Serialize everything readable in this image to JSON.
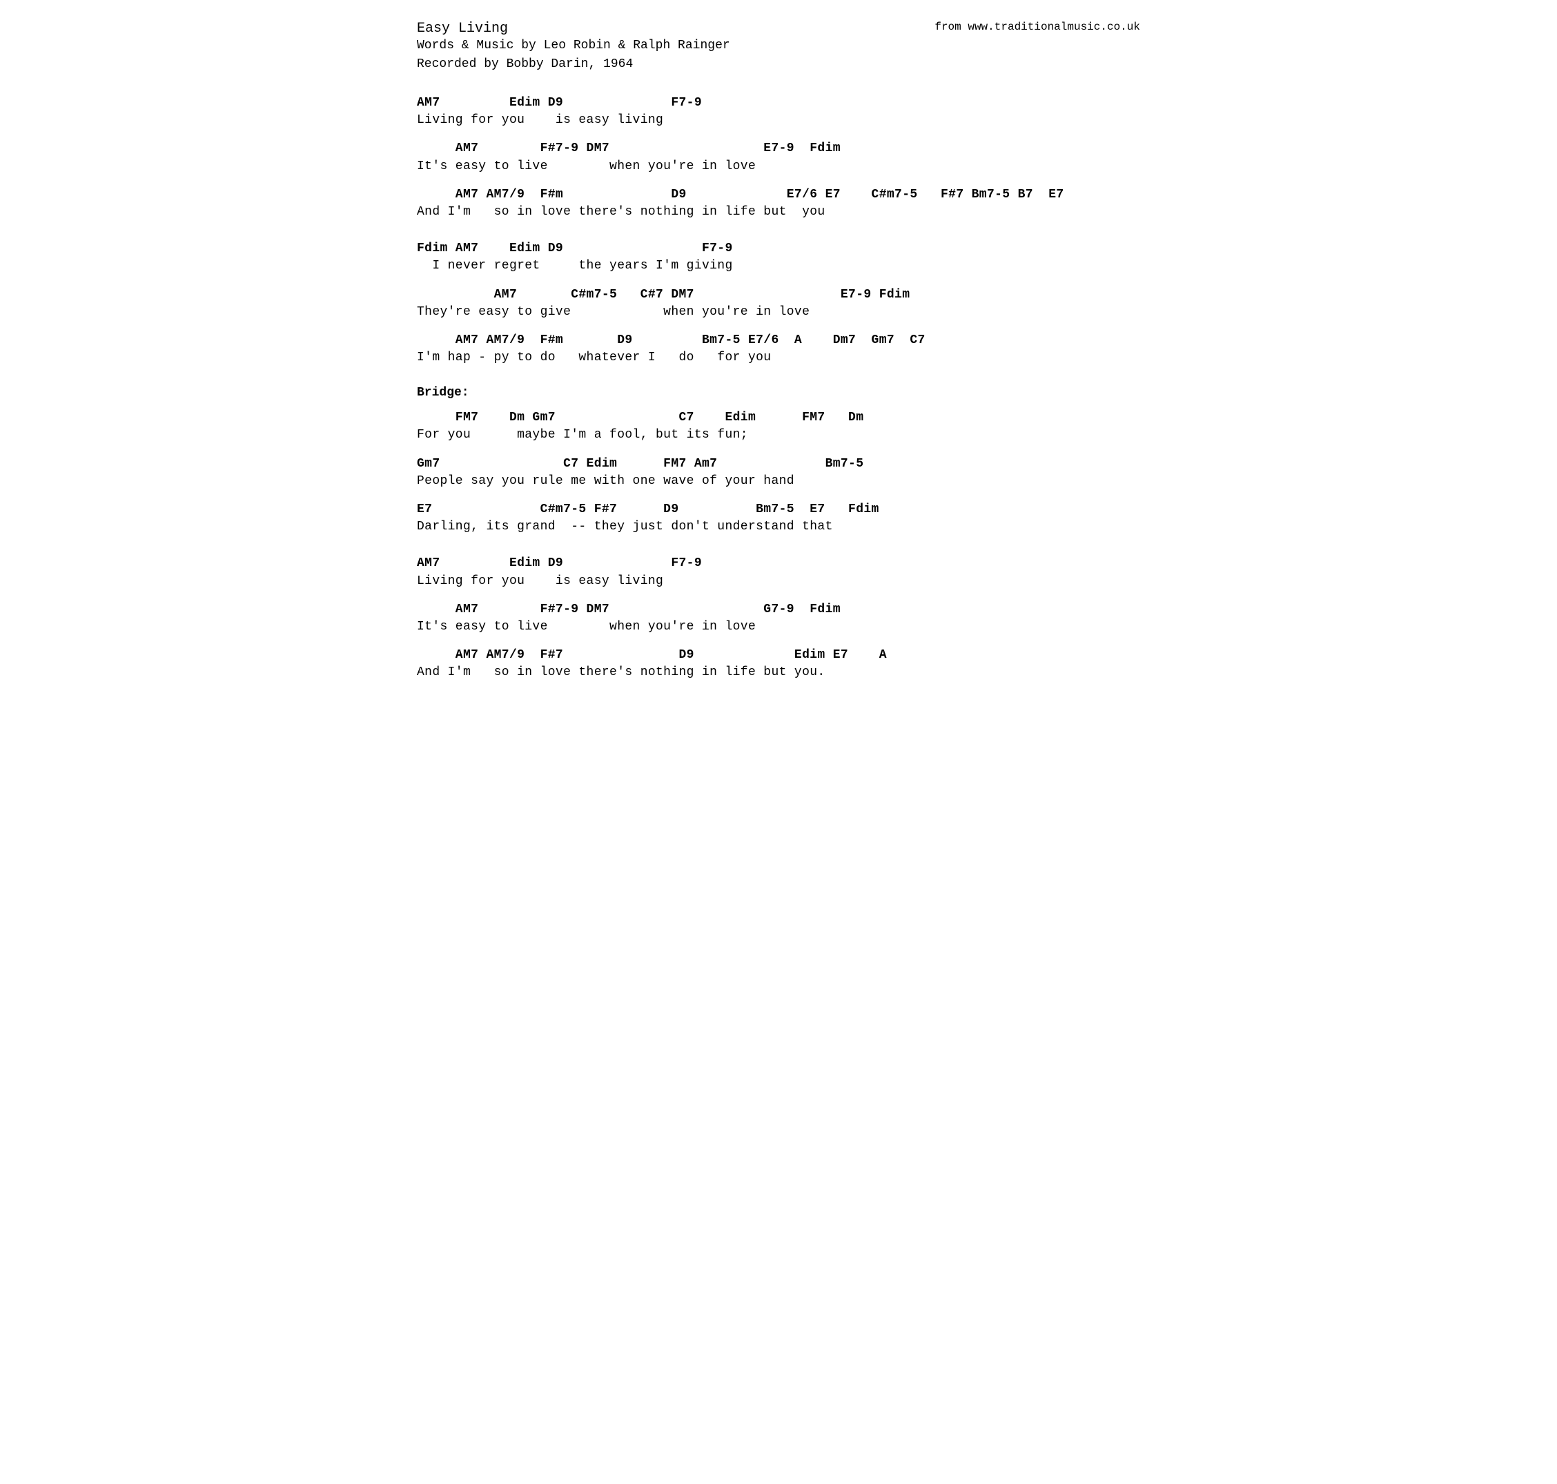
{
  "header": {
    "title": "Easy Living",
    "credits_line1": "Words & Music by Leo Robin & Ralph Rainger",
    "credits_line2": "Recorded by Bobby Darin, 1964",
    "source": "from www.traditionalmusic.co.uk"
  },
  "sections": [
    {
      "id": "verse1a",
      "chord": "AM7         Edim D9              F7-9",
      "lyric": "Living for you    is easy living"
    },
    {
      "id": "verse1b",
      "chord": "     AM7        F#7-9 DM7                    E7-9  Fdim",
      "lyric": "It's easy to live        when you're in love"
    },
    {
      "id": "verse1c",
      "chord": "     AM7 AM7/9  F#m              D9             E7/6 E7    C#m7-5   F#7 Bm7-5 B7  E7",
      "lyric": "And I'm   so in love there's nothing in life but  you"
    },
    {
      "id": "verse2a",
      "chord": "Fdim AM7    Edim D9                  F7-9",
      "lyric": "  I never regret     the years I'm giving"
    },
    {
      "id": "verse2b",
      "chord": "          AM7       C#m7-5   C#7 DM7                   E7-9 Fdim",
      "lyric": "They're easy to give            when you're in love"
    },
    {
      "id": "verse2c",
      "chord": "     AM7 AM7/9  F#m       D9         Bm7-5 E7/6  A    Dm7  Gm7  C7",
      "lyric": "I'm hap - py to do   whatever I   do   for you"
    },
    {
      "id": "bridge_label",
      "label": "Bridge:"
    },
    {
      "id": "bridge1",
      "chord": "     FM7    Dm Gm7                C7    Edim      FM7   Dm",
      "lyric": "For you      maybe I'm a fool, but its fun;"
    },
    {
      "id": "bridge2",
      "chord": "Gm7                C7 Edim      FM7 Am7              Bm7-5",
      "lyric": "People say you rule me with one wave of your hand"
    },
    {
      "id": "bridge3",
      "chord": "E7              C#m7-5 F#7      D9          Bm7-5  E7   Fdim",
      "lyric": "Darling, its grand  -- they just don't understand that"
    },
    {
      "id": "verse3a",
      "chord": "AM7         Edim D9              F7-9",
      "lyric": "Living for you    is easy living"
    },
    {
      "id": "verse3b",
      "chord": "     AM7        F#7-9 DM7                    G7-9  Fdim",
      "lyric": "It's easy to live        when you're in love"
    },
    {
      "id": "verse3c",
      "chord": "     AM7 AM7/9  F#7               D9             Edim E7    A",
      "lyric": "And I'm   so in love there's nothing in life but you."
    }
  ]
}
